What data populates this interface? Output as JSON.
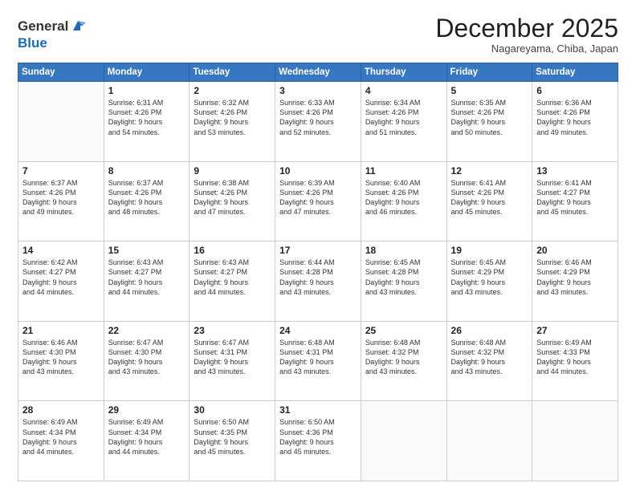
{
  "header": {
    "logo": {
      "general": "General",
      "blue": "Blue"
    },
    "title": "December 2025",
    "subtitle": "Nagareyama, Chiba, Japan"
  },
  "weekdays": [
    "Sunday",
    "Monday",
    "Tuesday",
    "Wednesday",
    "Thursday",
    "Friday",
    "Saturday"
  ],
  "weeks": [
    [
      {
        "day": "",
        "info": ""
      },
      {
        "day": "1",
        "info": "Sunrise: 6:31 AM\nSunset: 4:26 PM\nDaylight: 9 hours\nand 54 minutes."
      },
      {
        "day": "2",
        "info": "Sunrise: 6:32 AM\nSunset: 4:26 PM\nDaylight: 9 hours\nand 53 minutes."
      },
      {
        "day": "3",
        "info": "Sunrise: 6:33 AM\nSunset: 4:26 PM\nDaylight: 9 hours\nand 52 minutes."
      },
      {
        "day": "4",
        "info": "Sunrise: 6:34 AM\nSunset: 4:26 PM\nDaylight: 9 hours\nand 51 minutes."
      },
      {
        "day": "5",
        "info": "Sunrise: 6:35 AM\nSunset: 4:26 PM\nDaylight: 9 hours\nand 50 minutes."
      },
      {
        "day": "6",
        "info": "Sunrise: 6:36 AM\nSunset: 4:26 PM\nDaylight: 9 hours\nand 49 minutes."
      }
    ],
    [
      {
        "day": "7",
        "info": "Sunrise: 6:37 AM\nSunset: 4:26 PM\nDaylight: 9 hours\nand 49 minutes."
      },
      {
        "day": "8",
        "info": "Sunrise: 6:37 AM\nSunset: 4:26 PM\nDaylight: 9 hours\nand 48 minutes."
      },
      {
        "day": "9",
        "info": "Sunrise: 6:38 AM\nSunset: 4:26 PM\nDaylight: 9 hours\nand 47 minutes."
      },
      {
        "day": "10",
        "info": "Sunrise: 6:39 AM\nSunset: 4:26 PM\nDaylight: 9 hours\nand 47 minutes."
      },
      {
        "day": "11",
        "info": "Sunrise: 6:40 AM\nSunset: 4:26 PM\nDaylight: 9 hours\nand 46 minutes."
      },
      {
        "day": "12",
        "info": "Sunrise: 6:41 AM\nSunset: 4:26 PM\nDaylight: 9 hours\nand 45 minutes."
      },
      {
        "day": "13",
        "info": "Sunrise: 6:41 AM\nSunset: 4:27 PM\nDaylight: 9 hours\nand 45 minutes."
      }
    ],
    [
      {
        "day": "14",
        "info": "Sunrise: 6:42 AM\nSunset: 4:27 PM\nDaylight: 9 hours\nand 44 minutes."
      },
      {
        "day": "15",
        "info": "Sunrise: 6:43 AM\nSunset: 4:27 PM\nDaylight: 9 hours\nand 44 minutes."
      },
      {
        "day": "16",
        "info": "Sunrise: 6:43 AM\nSunset: 4:27 PM\nDaylight: 9 hours\nand 44 minutes."
      },
      {
        "day": "17",
        "info": "Sunrise: 6:44 AM\nSunset: 4:28 PM\nDaylight: 9 hours\nand 43 minutes."
      },
      {
        "day": "18",
        "info": "Sunrise: 6:45 AM\nSunset: 4:28 PM\nDaylight: 9 hours\nand 43 minutes."
      },
      {
        "day": "19",
        "info": "Sunrise: 6:45 AM\nSunset: 4:29 PM\nDaylight: 9 hours\nand 43 minutes."
      },
      {
        "day": "20",
        "info": "Sunrise: 6:46 AM\nSunset: 4:29 PM\nDaylight: 9 hours\nand 43 minutes."
      }
    ],
    [
      {
        "day": "21",
        "info": "Sunrise: 6:46 AM\nSunset: 4:30 PM\nDaylight: 9 hours\nand 43 minutes."
      },
      {
        "day": "22",
        "info": "Sunrise: 6:47 AM\nSunset: 4:30 PM\nDaylight: 9 hours\nand 43 minutes."
      },
      {
        "day": "23",
        "info": "Sunrise: 6:47 AM\nSunset: 4:31 PM\nDaylight: 9 hours\nand 43 minutes."
      },
      {
        "day": "24",
        "info": "Sunrise: 6:48 AM\nSunset: 4:31 PM\nDaylight: 9 hours\nand 43 minutes."
      },
      {
        "day": "25",
        "info": "Sunrise: 6:48 AM\nSunset: 4:32 PM\nDaylight: 9 hours\nand 43 minutes."
      },
      {
        "day": "26",
        "info": "Sunrise: 6:48 AM\nSunset: 4:32 PM\nDaylight: 9 hours\nand 43 minutes."
      },
      {
        "day": "27",
        "info": "Sunrise: 6:49 AM\nSunset: 4:33 PM\nDaylight: 9 hours\nand 44 minutes."
      }
    ],
    [
      {
        "day": "28",
        "info": "Sunrise: 6:49 AM\nSunset: 4:34 PM\nDaylight: 9 hours\nand 44 minutes."
      },
      {
        "day": "29",
        "info": "Sunrise: 6:49 AM\nSunset: 4:34 PM\nDaylight: 9 hours\nand 44 minutes."
      },
      {
        "day": "30",
        "info": "Sunrise: 6:50 AM\nSunset: 4:35 PM\nDaylight: 9 hours\nand 45 minutes."
      },
      {
        "day": "31",
        "info": "Sunrise: 6:50 AM\nSunset: 4:36 PM\nDaylight: 9 hours\nand 45 minutes."
      },
      {
        "day": "",
        "info": ""
      },
      {
        "day": "",
        "info": ""
      },
      {
        "day": "",
        "info": ""
      }
    ]
  ]
}
